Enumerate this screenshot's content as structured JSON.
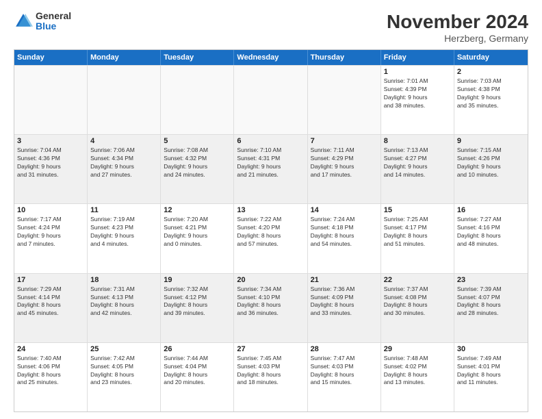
{
  "logo": {
    "general": "General",
    "blue": "Blue"
  },
  "title": "November 2024",
  "subtitle": "Herzberg, Germany",
  "header_days": [
    "Sunday",
    "Monday",
    "Tuesday",
    "Wednesday",
    "Thursday",
    "Friday",
    "Saturday"
  ],
  "weeks": [
    [
      {
        "day": "",
        "info": ""
      },
      {
        "day": "",
        "info": ""
      },
      {
        "day": "",
        "info": ""
      },
      {
        "day": "",
        "info": ""
      },
      {
        "day": "",
        "info": ""
      },
      {
        "day": "1",
        "info": "Sunrise: 7:01 AM\nSunset: 4:39 PM\nDaylight: 9 hours\nand 38 minutes."
      },
      {
        "day": "2",
        "info": "Sunrise: 7:03 AM\nSunset: 4:38 PM\nDaylight: 9 hours\nand 35 minutes."
      }
    ],
    [
      {
        "day": "3",
        "info": "Sunrise: 7:04 AM\nSunset: 4:36 PM\nDaylight: 9 hours\nand 31 minutes."
      },
      {
        "day": "4",
        "info": "Sunrise: 7:06 AM\nSunset: 4:34 PM\nDaylight: 9 hours\nand 27 minutes."
      },
      {
        "day": "5",
        "info": "Sunrise: 7:08 AM\nSunset: 4:32 PM\nDaylight: 9 hours\nand 24 minutes."
      },
      {
        "day": "6",
        "info": "Sunrise: 7:10 AM\nSunset: 4:31 PM\nDaylight: 9 hours\nand 21 minutes."
      },
      {
        "day": "7",
        "info": "Sunrise: 7:11 AM\nSunset: 4:29 PM\nDaylight: 9 hours\nand 17 minutes."
      },
      {
        "day": "8",
        "info": "Sunrise: 7:13 AM\nSunset: 4:27 PM\nDaylight: 9 hours\nand 14 minutes."
      },
      {
        "day": "9",
        "info": "Sunrise: 7:15 AM\nSunset: 4:26 PM\nDaylight: 9 hours\nand 10 minutes."
      }
    ],
    [
      {
        "day": "10",
        "info": "Sunrise: 7:17 AM\nSunset: 4:24 PM\nDaylight: 9 hours\nand 7 minutes."
      },
      {
        "day": "11",
        "info": "Sunrise: 7:19 AM\nSunset: 4:23 PM\nDaylight: 9 hours\nand 4 minutes."
      },
      {
        "day": "12",
        "info": "Sunrise: 7:20 AM\nSunset: 4:21 PM\nDaylight: 9 hours\nand 0 minutes."
      },
      {
        "day": "13",
        "info": "Sunrise: 7:22 AM\nSunset: 4:20 PM\nDaylight: 8 hours\nand 57 minutes."
      },
      {
        "day": "14",
        "info": "Sunrise: 7:24 AM\nSunset: 4:18 PM\nDaylight: 8 hours\nand 54 minutes."
      },
      {
        "day": "15",
        "info": "Sunrise: 7:25 AM\nSunset: 4:17 PM\nDaylight: 8 hours\nand 51 minutes."
      },
      {
        "day": "16",
        "info": "Sunrise: 7:27 AM\nSunset: 4:16 PM\nDaylight: 8 hours\nand 48 minutes."
      }
    ],
    [
      {
        "day": "17",
        "info": "Sunrise: 7:29 AM\nSunset: 4:14 PM\nDaylight: 8 hours\nand 45 minutes."
      },
      {
        "day": "18",
        "info": "Sunrise: 7:31 AM\nSunset: 4:13 PM\nDaylight: 8 hours\nand 42 minutes."
      },
      {
        "day": "19",
        "info": "Sunrise: 7:32 AM\nSunset: 4:12 PM\nDaylight: 8 hours\nand 39 minutes."
      },
      {
        "day": "20",
        "info": "Sunrise: 7:34 AM\nSunset: 4:10 PM\nDaylight: 8 hours\nand 36 minutes."
      },
      {
        "day": "21",
        "info": "Sunrise: 7:36 AM\nSunset: 4:09 PM\nDaylight: 8 hours\nand 33 minutes."
      },
      {
        "day": "22",
        "info": "Sunrise: 7:37 AM\nSunset: 4:08 PM\nDaylight: 8 hours\nand 30 minutes."
      },
      {
        "day": "23",
        "info": "Sunrise: 7:39 AM\nSunset: 4:07 PM\nDaylight: 8 hours\nand 28 minutes."
      }
    ],
    [
      {
        "day": "24",
        "info": "Sunrise: 7:40 AM\nSunset: 4:06 PM\nDaylight: 8 hours\nand 25 minutes."
      },
      {
        "day": "25",
        "info": "Sunrise: 7:42 AM\nSunset: 4:05 PM\nDaylight: 8 hours\nand 23 minutes."
      },
      {
        "day": "26",
        "info": "Sunrise: 7:44 AM\nSunset: 4:04 PM\nDaylight: 8 hours\nand 20 minutes."
      },
      {
        "day": "27",
        "info": "Sunrise: 7:45 AM\nSunset: 4:03 PM\nDaylight: 8 hours\nand 18 minutes."
      },
      {
        "day": "28",
        "info": "Sunrise: 7:47 AM\nSunset: 4:03 PM\nDaylight: 8 hours\nand 15 minutes."
      },
      {
        "day": "29",
        "info": "Sunrise: 7:48 AM\nSunset: 4:02 PM\nDaylight: 8 hours\nand 13 minutes."
      },
      {
        "day": "30",
        "info": "Sunrise: 7:49 AM\nSunset: 4:01 PM\nDaylight: 8 hours\nand 11 minutes."
      }
    ]
  ]
}
